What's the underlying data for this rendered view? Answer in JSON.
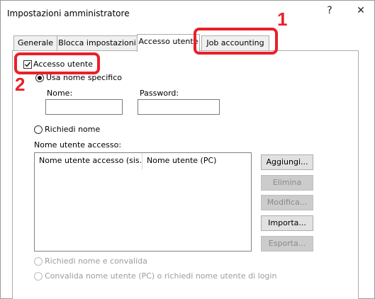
{
  "window": {
    "title": "Impostazioni amministratore",
    "help_label": "?",
    "close_label": "✕"
  },
  "tabs": [
    {
      "label": "Generale"
    },
    {
      "label": "Blocca impostazioni"
    },
    {
      "label": "Accesso utente"
    },
    {
      "label": "Job accounting"
    }
  ],
  "active_tab": "Accesso utente",
  "panel": {
    "accesso_utente": {
      "label": "Accesso utente",
      "checked": true
    },
    "usa_nome_specifico": {
      "label": "Usa nome specifico",
      "selected": true
    },
    "nome_label": "Nome:",
    "nome_value": "",
    "password_label": "Password:",
    "password_value": "",
    "richiedi_nome": {
      "label": "Richiedi nome",
      "selected": false
    },
    "list_title": "Nome utente accesso:",
    "list_columns": [
      "Nome utente accesso (sis...",
      "Nome utente (PC)"
    ],
    "buttons": {
      "aggiungi": "Aggiungi...",
      "elimina": "Elimina",
      "modifica": "Modifica...",
      "importa": "Importa...",
      "esporta": "Esporta..."
    },
    "richiedi_nome_convalida": "Richiedi nome e convalida",
    "convalida_nome_utente": "Convalida nome utente (PC) o richiedi nome utente di login"
  },
  "callouts": {
    "step1": "1",
    "step2": "2",
    "color": "#e8202a"
  }
}
